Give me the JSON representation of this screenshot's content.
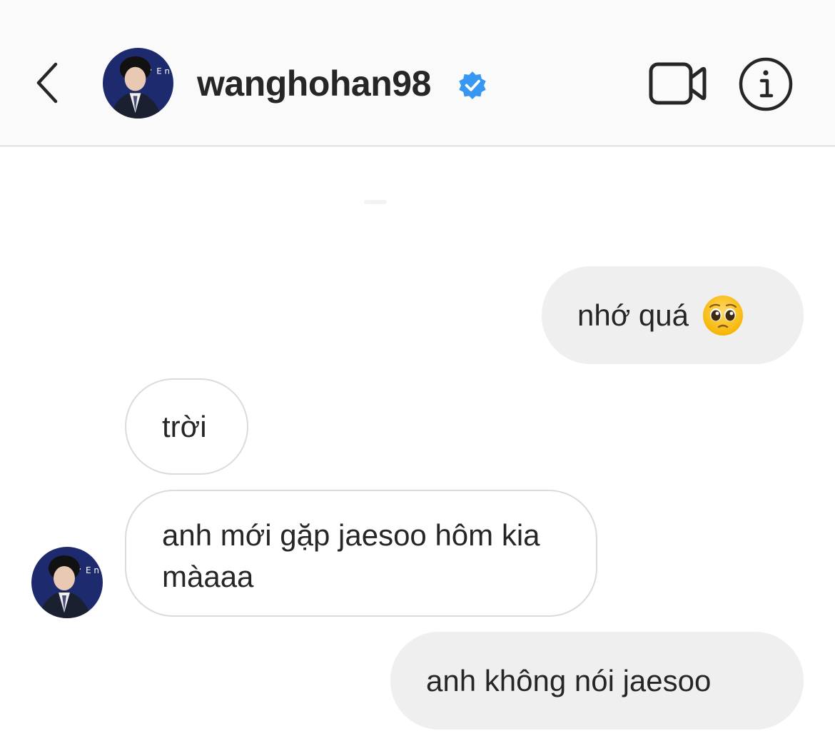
{
  "header": {
    "username": "wanghohan98",
    "verified": true
  },
  "messages": [
    {
      "direction": "sent",
      "text": "nhớ quá",
      "emoji": "pleading-face-emoji"
    },
    {
      "direction": "received",
      "text": "trời"
    },
    {
      "direction": "received",
      "text": "anh mới gặp jaesoo hôm kia màaaa"
    },
    {
      "direction": "sent",
      "text": "anh không nói jaesoo"
    }
  ],
  "colors": {
    "header_bg": "#fafafa",
    "sent_bubble": "#efefef",
    "received_border": "#dbdbdb",
    "verified_blue": "#3897f0",
    "text": "#262626"
  }
}
